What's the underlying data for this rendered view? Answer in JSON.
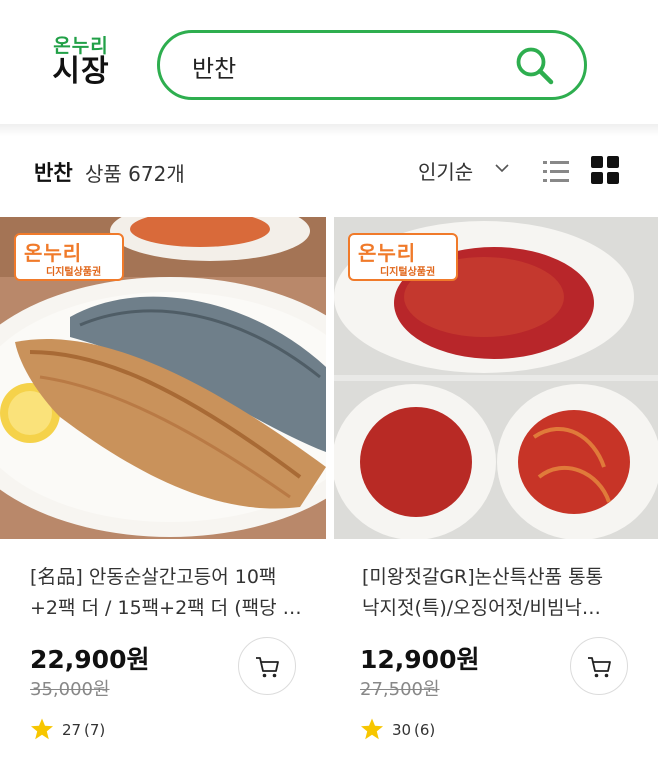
{
  "header": {
    "logo_top": "온누리",
    "logo_bottom": "시장",
    "search_value": "반찬"
  },
  "filter": {
    "keyword": "반찬",
    "count_text": "상품 672개",
    "sort_label": "인기순"
  },
  "badge": {
    "main": "온누리",
    "sub": "디지털상품권"
  },
  "products": [
    {
      "name_line1": "[名品] 안동순살간고등어 10팩",
      "name_line2": "+2팩 더 / 15팩+2팩 더 (팩당 …",
      "price": "22,900원",
      "original_price": "35,000원",
      "rating_score": "27",
      "rating_count": "(7)"
    },
    {
      "name_line1": "[미왕젓갈GR]논산특산품 통통",
      "name_line2": "낙지젓(특)/오징어젓/비빔낙…",
      "price": "12,900원",
      "original_price": "27,500원",
      "rating_score": "30",
      "rating_count": "(6)"
    }
  ],
  "colors": {
    "brand_green": "#2eae4f",
    "badge_orange": "#f07a2a",
    "star_yellow": "#f7c600"
  }
}
